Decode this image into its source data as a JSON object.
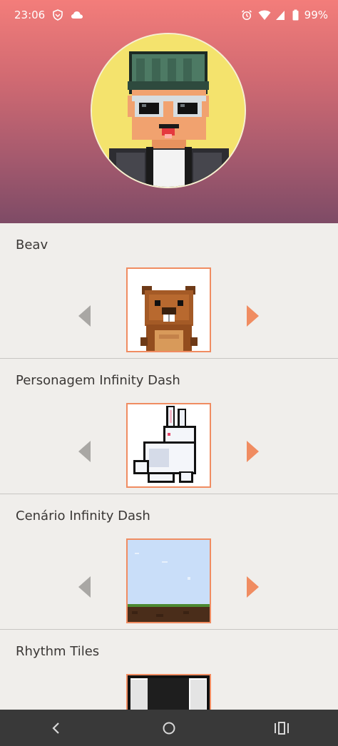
{
  "status_bar": {
    "time": "23:06",
    "battery": "99%",
    "icons_left": [
      "shield-icon",
      "cloud-icon"
    ],
    "icons_right": [
      "alarm-icon",
      "wifi-icon",
      "signal-icon",
      "battery-icon"
    ]
  },
  "profile": {
    "avatar": "pixel-avatar-beanie-sunglasses"
  },
  "cards": [
    {
      "title": "Beav",
      "image": "beaver-sprite"
    },
    {
      "title": "Personagem Infinity Dash",
      "image": "rabbit-sprite"
    },
    {
      "title": "Cenário Infinity Dash",
      "image": "sky-ground-scene"
    },
    {
      "title": "Rhythm Tiles",
      "image": "piano-tiles"
    }
  ],
  "nav_bar": {
    "buttons": [
      "back-icon",
      "home-icon",
      "recents-icon"
    ]
  },
  "colors": {
    "accent": "#f08c61",
    "arrow_disabled": "#a9a7a4",
    "header_top": "#f37d7a",
    "header_bottom": "#7e4b66",
    "background": "#f0eeeb",
    "nav_bar": "#393939"
  }
}
